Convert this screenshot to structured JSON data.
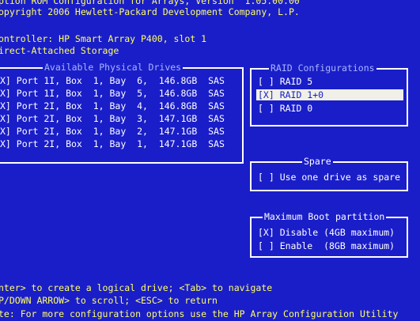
{
  "header": {
    "version_line": "ption ROM Configuration for Arrays, Version  1.05.00.00",
    "copyright": "opyright 2006 Hewlett-Packard Development Company, L.P.",
    "controller": "ontroller: HP Smart Array P400, slot 1",
    "storage": "irect-Attached Storage"
  },
  "drives": {
    "title": "Available Physical Drives",
    "items": [
      "X] Port 1I, Box  1, Bay  6,  146.8GB  SAS",
      "X] Port 1I, Box  1, Bay  5,  146.8GB  SAS",
      "X] Port 2I, Box  1, Bay  4,  146.8GB  SAS",
      "X] Port 2I, Box  1, Bay  3,  147.1GB  SAS",
      "X] Port 2I, Box  1, Bay  2,  147.1GB  SAS",
      "X] Port 2I, Box  1, Bay  1,  147.1GB  SAS"
    ]
  },
  "raid": {
    "title": "RAID Configurations",
    "options": [
      "[ ] RAID 5",
      "[X] RAID 1+0",
      "[ ] RAID 0"
    ],
    "selected_index": 1
  },
  "spare": {
    "title": "Spare",
    "option": "[ ] Use one drive as spare"
  },
  "boot": {
    "title": "Maximum Boot partition",
    "options": [
      "[X] Disable (4GB maximum)",
      "[ ] Enable  (8GB maximum)"
    ]
  },
  "footer": {
    "line1": "nter> to create a logical drive; <Tab> to navigate",
    "line2": "P/DOWN ARROW> to scroll; <ESC> to return",
    "line3": "te: For more configuration options use the HP Array Configuration Utility"
  },
  "colors": {
    "background": "#1a1ec8",
    "highlight": "#ffff66",
    "selection": "#f0f0e8"
  }
}
